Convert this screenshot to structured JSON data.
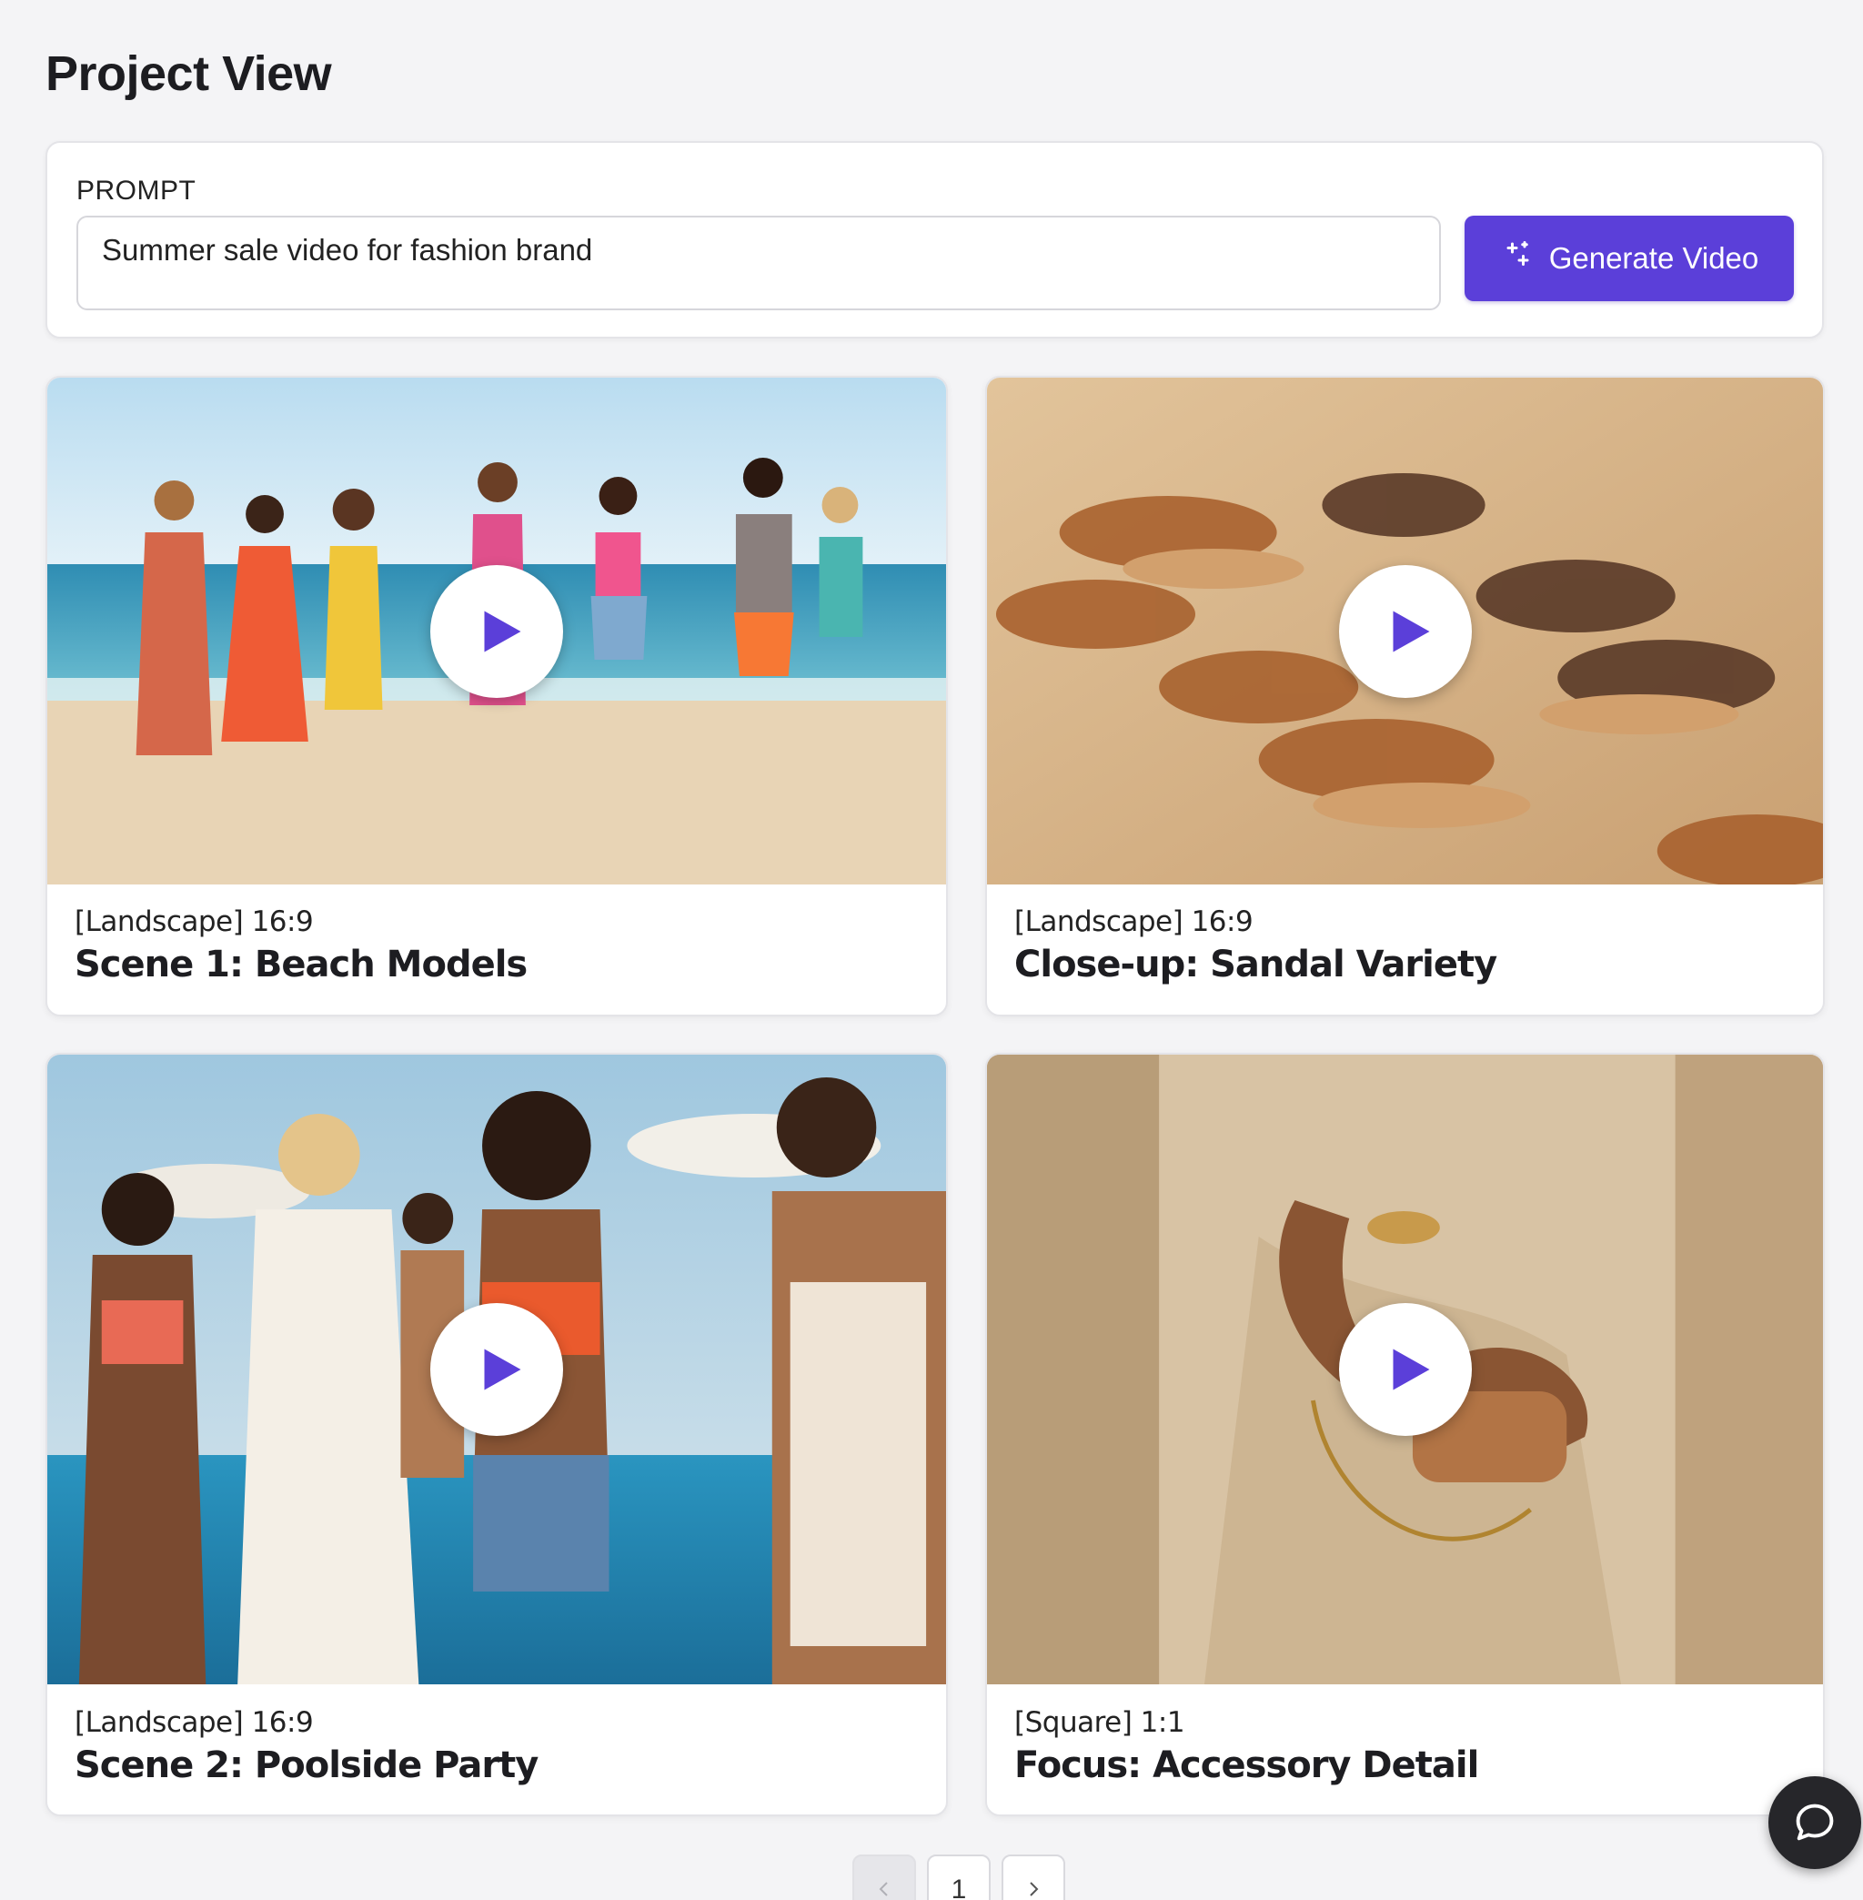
{
  "page": {
    "title": "Project View"
  },
  "prompt": {
    "label": "PROMPT",
    "value": "Summer sale video for fashion brand",
    "generate_label": "Generate Video",
    "generate_icon": "sparkles-icon"
  },
  "scenes": [
    {
      "format": "[Landscape] 16:9",
      "title": "Scene 1: Beach Models",
      "thumbnail": "beach-models"
    },
    {
      "format": "[Landscape] 16:9",
      "title": "Close-up: Sandal Variety",
      "thumbnail": "sandals-on-sand"
    },
    {
      "format": "[Landscape] 16:9",
      "title": "Scene 2: Poolside Party",
      "thumbnail": "poolside-party"
    },
    {
      "format": "[Square] 1:1",
      "title": "Focus: Accessory Detail",
      "thumbnail": "accessory-detail"
    }
  ],
  "pagination": {
    "current_page": "1",
    "prev_icon": "chevron-left-icon",
    "next_icon": "chevron-right-icon"
  },
  "chat": {
    "icon": "chat-bubble-icon"
  },
  "colors": {
    "accent": "#5b3fd9",
    "play_icon": "#5b3fd9",
    "page_background": "#f4f4f6",
    "card_background": "#ffffff"
  }
}
